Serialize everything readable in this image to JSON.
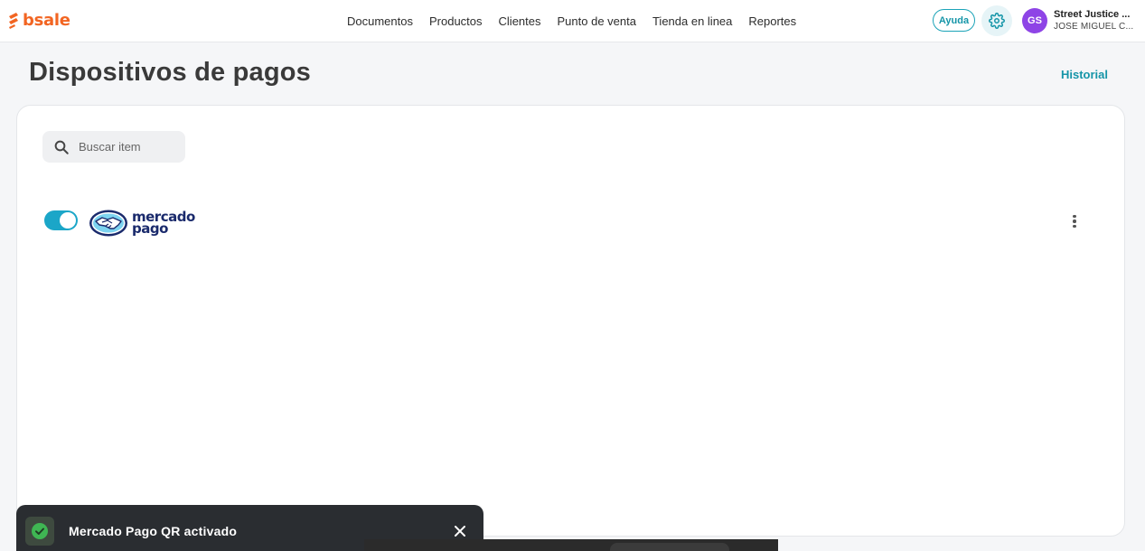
{
  "brand": {
    "name": "bsale",
    "color": "#f26522"
  },
  "nav": [
    {
      "label": "Documentos"
    },
    {
      "label": "Productos"
    },
    {
      "label": "Clientes"
    },
    {
      "label": "Punto de venta"
    },
    {
      "label": "Tienda en linea"
    },
    {
      "label": "Reportes"
    }
  ],
  "header": {
    "help_label": "Ayuda",
    "settings_icon": "gear-icon",
    "avatar_initials": "GS",
    "account_name": "Street Justice ...",
    "account_user": "JOSE MIGUEL C..."
  },
  "page": {
    "title": "Dispositivos de pagos",
    "history_link": "Historial"
  },
  "search": {
    "placeholder": "Buscar item",
    "value": ""
  },
  "devices": [
    {
      "name_line1": "mercado",
      "name_line2": "pago",
      "enabled": true,
      "logo_icon": "mercado-pago-logo"
    }
  ],
  "toast": {
    "message": "Mercado Pago QR activado",
    "status": "success"
  },
  "colors": {
    "accent": "#1ba6c8",
    "link": "#1595a8",
    "avatar": "#8e44e6",
    "toast_bg": "#2a2d31",
    "success": "#3fb653"
  }
}
